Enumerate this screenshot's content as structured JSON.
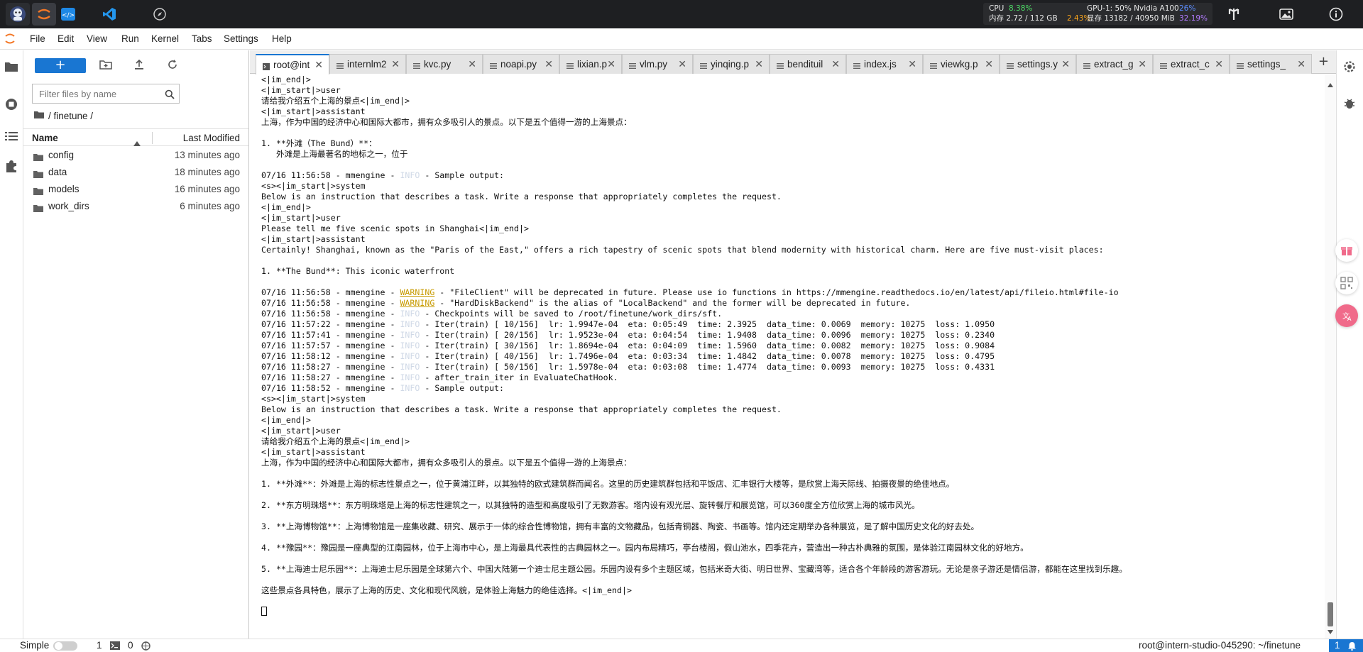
{
  "topbar": {
    "cpu_label": "CPU",
    "cpu_value": "8.38%",
    "mem_label": "内存 2.72 / 112 GB",
    "mem_value": "2.43%",
    "gpu_label": "GPU-1: 50% Nvidia A100",
    "gpu_value": "26%",
    "vram_label": "显存 13182 / 40950 MiB",
    "vram_value": "32.19%",
    "apps": [
      "home-avatar-icon",
      "jupyter-icon",
      "code-tag-icon",
      "vscode-icon",
      "compass-icon"
    ]
  },
  "menu": {
    "items": [
      "File",
      "Edit",
      "View",
      "Run",
      "Kernel",
      "Tabs",
      "Settings",
      "Help"
    ]
  },
  "filebrowser": {
    "new_label": "+",
    "search_placeholder": "Filter files by name",
    "breadcrumb": "/ finetune /",
    "col_name": "Name",
    "col_modified": "Last Modified",
    "files": [
      {
        "name": "config",
        "modified": "13 minutes ago"
      },
      {
        "name": "data",
        "modified": "18 minutes ago"
      },
      {
        "name": "models",
        "modified": "16 minutes ago"
      },
      {
        "name": "work_dirs",
        "modified": "6 minutes ago"
      }
    ]
  },
  "tabs": [
    {
      "label": "root@int",
      "type": "terminal",
      "active": true
    },
    {
      "label": "internlm2",
      "type": "text",
      "active": false
    },
    {
      "label": "kvc.py",
      "type": "text",
      "active": false
    },
    {
      "label": "noapi.py",
      "type": "text",
      "active": false
    },
    {
      "label": "lixian.py",
      "type": "text",
      "active": false
    },
    {
      "label": "vlm.py",
      "type": "text",
      "active": false
    },
    {
      "label": "yinqing.p",
      "type": "text",
      "active": false
    },
    {
      "label": "bendituil",
      "type": "text",
      "active": false
    },
    {
      "label": "index.js",
      "type": "text",
      "active": false
    },
    {
      "label": "viewkg.p",
      "type": "text",
      "active": false
    },
    {
      "label": "settings.y",
      "type": "text",
      "active": false
    },
    {
      "label": "extract_g",
      "type": "text",
      "active": false
    },
    {
      "label": "extract_c",
      "type": "text",
      "active": false
    },
    {
      "label": "settings_",
      "type": "text",
      "active": false
    }
  ],
  "terminal": {
    "lines": [
      {
        "t": "<|im_end|>"
      },
      {
        "t": "<|im_start|>user"
      },
      {
        "t": "请给我介绍五个上海的景点<|im_end|>"
      },
      {
        "t": "<|im_start|>assistant"
      },
      {
        "t": "上海，作为中国的经济中心和国际大都市，拥有众多吸引人的景点。以下是五个值得一游的上海景点："
      },
      {
        "t": ""
      },
      {
        "t": "1. **外滩（The Bund）**："
      },
      {
        "t": "   外滩是上海最著名的地标之一，位于"
      },
      {
        "t": ""
      },
      {
        "p": "07/16 11:56:58 - mmengine - ",
        "lv": "INFO",
        "c": "info",
        "s": " - Sample output:"
      },
      {
        "t": "<s><|im_start|>system"
      },
      {
        "t": "Below is an instruction that describes a task. Write a response that appropriately completes the request."
      },
      {
        "t": "<|im_end|>"
      },
      {
        "t": "<|im_start|>user"
      },
      {
        "t": "Please tell me five scenic spots in Shanghai<|im_end|>"
      },
      {
        "t": "<|im_start|>assistant"
      },
      {
        "t": "Certainly! Shanghai, known as the \"Paris of the East,\" offers a rich tapestry of scenic spots that blend modernity with historical charm. Here are five must-visit places:"
      },
      {
        "t": ""
      },
      {
        "t": "1. **The Bund**: This iconic waterfront"
      },
      {
        "t": ""
      },
      {
        "p": "07/16 11:56:58 - mmengine - ",
        "lv": "WARNING",
        "c": "warn",
        "s": " - \"FileClient\" will be deprecated in future. Please use io functions in https://mmengine.readthedocs.io/en/latest/api/fileio.html#file-io"
      },
      {
        "p": "07/16 11:56:58 - mmengine - ",
        "lv": "WARNING",
        "c": "warn",
        "s": " - \"HardDiskBackend\" is the alias of \"LocalBackend\" and the former will be deprecated in future."
      },
      {
        "p": "07/16 11:56:58 - mmengine - ",
        "lv": "INFO",
        "c": "info",
        "s": " - Checkpoints will be saved to /root/finetune/work_dirs/sft."
      },
      {
        "p": "07/16 11:57:22 - mmengine - ",
        "lv": "INFO",
        "c": "info",
        "s": " - Iter(train) [ 10/156]  lr: 1.9947e-04  eta: 0:05:49  time: 2.3925  data_time: 0.0069  memory: 10275  loss: 1.0950"
      },
      {
        "p": "07/16 11:57:41 - mmengine - ",
        "lv": "INFO",
        "c": "info",
        "s": " - Iter(train) [ 20/156]  lr: 1.9523e-04  eta: 0:04:54  time: 1.9408  data_time: 0.0096  memory: 10275  loss: 0.2340"
      },
      {
        "p": "07/16 11:57:57 - mmengine - ",
        "lv": "INFO",
        "c": "info",
        "s": " - Iter(train) [ 30/156]  lr: 1.8694e-04  eta: 0:04:09  time: 1.5960  data_time: 0.0082  memory: 10275  loss: 0.9084"
      },
      {
        "p": "07/16 11:58:12 - mmengine - ",
        "lv": "INFO",
        "c": "info",
        "s": " - Iter(train) [ 40/156]  lr: 1.7496e-04  eta: 0:03:34  time: 1.4842  data_time: 0.0078  memory: 10275  loss: 0.4795"
      },
      {
        "p": "07/16 11:58:27 - mmengine - ",
        "lv": "INFO",
        "c": "info",
        "s": " - Iter(train) [ 50/156]  lr: 1.5978e-04  eta: 0:03:08  time: 1.4774  data_time: 0.0093  memory: 10275  loss: 0.4331"
      },
      {
        "p": "07/16 11:58:27 - mmengine - ",
        "lv": "INFO",
        "c": "info",
        "s": " - after_train_iter in EvaluateChatHook."
      },
      {
        "p": "07/16 11:58:52 - mmengine - ",
        "lv": "INFO",
        "c": "info",
        "s": " - Sample output:"
      },
      {
        "t": "<s><|im_start|>system"
      },
      {
        "t": "Below is an instruction that describes a task. Write a response that appropriately completes the request."
      },
      {
        "t": "<|im_end|>"
      },
      {
        "t": "<|im_start|>user"
      },
      {
        "t": "请给我介绍五个上海的景点<|im_end|>"
      },
      {
        "t": "<|im_start|>assistant"
      },
      {
        "t": "上海，作为中国的经济中心和国际大都市，拥有众多吸引人的景点。以下是五个值得一游的上海景点："
      },
      {
        "t": ""
      },
      {
        "t": "1. **外滩**：外滩是上海的标志性景点之一，位于黄浦江畔，以其独特的欧式建筑群而闻名。这里的历史建筑群包括和平饭店、汇丰银行大楼等，是欣赏上海天际线、拍摄夜景的绝佳地点。"
      },
      {
        "t": ""
      },
      {
        "t": "2. **东方明珠塔**：东方明珠塔是上海的标志性建筑之一，以其独特的造型和高度吸引了无数游客。塔内设有观光层、旋转餐厅和展览馆，可以360度全方位欣赏上海的城市风光。"
      },
      {
        "t": ""
      },
      {
        "t": "3. **上海博物馆**：上海博物馆是一座集收藏、研究、展示于一体的综合性博物馆，拥有丰富的文物藏品，包括青铜器、陶瓷、书画等。馆内还定期举办各种展览，是了解中国历史文化的好去处。"
      },
      {
        "t": ""
      },
      {
        "t": "4. **豫园**：豫园是一座典型的江南园林，位于上海市中心，是上海最具代表性的古典园林之一。园内布局精巧，亭台楼阁，假山池水，四季花卉，营造出一种古朴典雅的氛围，是体验江南园林文化的好地方。"
      },
      {
        "t": ""
      },
      {
        "t": "5. **上海迪士尼乐园**：上海迪士尼乐园是全球第六个、中国大陆第一个迪士尼主题公园。乐园内设有多个主题区域，包括米奇大街、明日世界、宝藏湾等，适合各个年龄段的游客游玩。无论是亲子游还是情侣游，都能在这里找到乐趣。"
      },
      {
        "t": ""
      },
      {
        "t": "这些景点各具特色，展示了上海的历史、文化和现代风貌，是体验上海魅力的绝佳选择。<|im_end|>"
      },
      {
        "t": ""
      },
      {
        "cursor": true
      }
    ]
  },
  "statusbar": {
    "mode_label": "Simple",
    "kernels": "1",
    "terminals": "0",
    "path": "root@intern-studio-045290: ~/finetune",
    "notifications": "1"
  },
  "colors": {
    "accent": "#1976d2",
    "warning": "#c79a00",
    "topbar_bg": "#1e1f22"
  }
}
